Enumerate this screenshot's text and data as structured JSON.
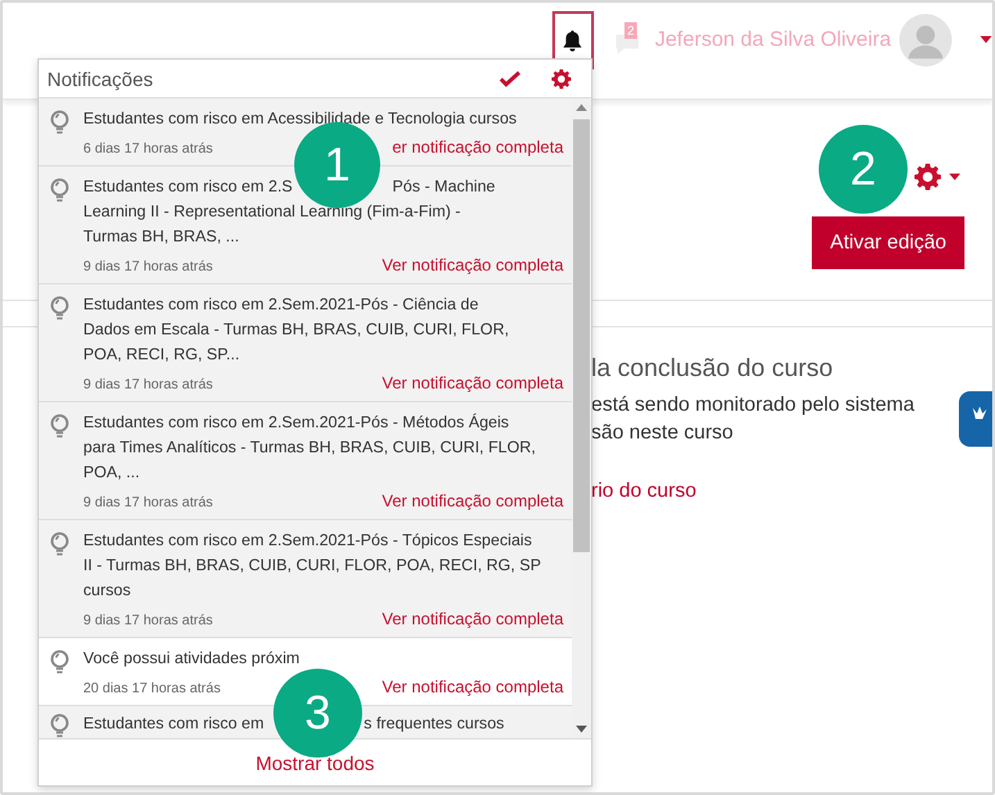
{
  "header": {
    "notifications_open": true,
    "messages_badge": "2",
    "user_name": "Jeferson da Silva Oliveira"
  },
  "notifications": {
    "title": "Notificações",
    "items": [
      {
        "lines": [
          "Estudantes com risco em Acessibilidade e Tecnologia cursos"
        ],
        "time": "6 dias 17 horas atrás",
        "link": "er notificação completa",
        "read": false
      },
      {
        "lines": [
          [
            "Estudantes com risco em 2.S",
            "Pós - Machine"
          ],
          "Learning II - Representational Learning (Fim-a-Fim) -",
          "Turmas BH, BRAS, ..."
        ],
        "time": "9 dias 17 horas atrás",
        "link": "Ver notificação completa",
        "read": false
      },
      {
        "lines": [
          "Estudantes com risco em 2.Sem.2021-Pós - Ciência de",
          "Dados em Escala - Turmas BH, BRAS, CUIB, CURI, FLOR,",
          "POA, RECI, RG, SP..."
        ],
        "time": "9 dias 17 horas atrás",
        "link": "Ver notificação completa",
        "read": false
      },
      {
        "lines": [
          "Estudantes com risco em 2.Sem.2021-Pós - Métodos Ágeis",
          "para Times Analíticos - Turmas BH, BRAS, CUIB, CURI, FLOR,",
          "POA, ..."
        ],
        "time": "9 dias 17 horas atrás",
        "link": "Ver notificação completa",
        "read": false
      },
      {
        "lines": [
          "Estudantes com risco em 2.Sem.2021-Pós - Tópicos Especiais",
          "II - Turmas BH, BRAS, CUIB, CURI, FLOR, POA, RECI, RG, SP",
          "cursos"
        ],
        "time": "9 dias 17 horas atrás",
        "link": "Ver notificação completa",
        "read": false
      },
      {
        "lines": [
          "Você possui atividades próxim"
        ],
        "time": "20 dias 17 horas atrás",
        "link": "Ver notificação completa",
        "read": true
      },
      {
        "lines": [
          [
            "Estudantes com risco em",
            "s frequentes cursos"
          ]
        ],
        "read": false
      }
    ],
    "footer": "Mostrar todos"
  },
  "page": {
    "button": "Ativar edição",
    "section_title": "la conclusão do curso",
    "lines": [
      "está sendo monitorado pelo sistema",
      "são neste curso"
    ],
    "link": "rio do curso"
  },
  "callouts": [
    "1",
    "2",
    "3"
  ]
}
